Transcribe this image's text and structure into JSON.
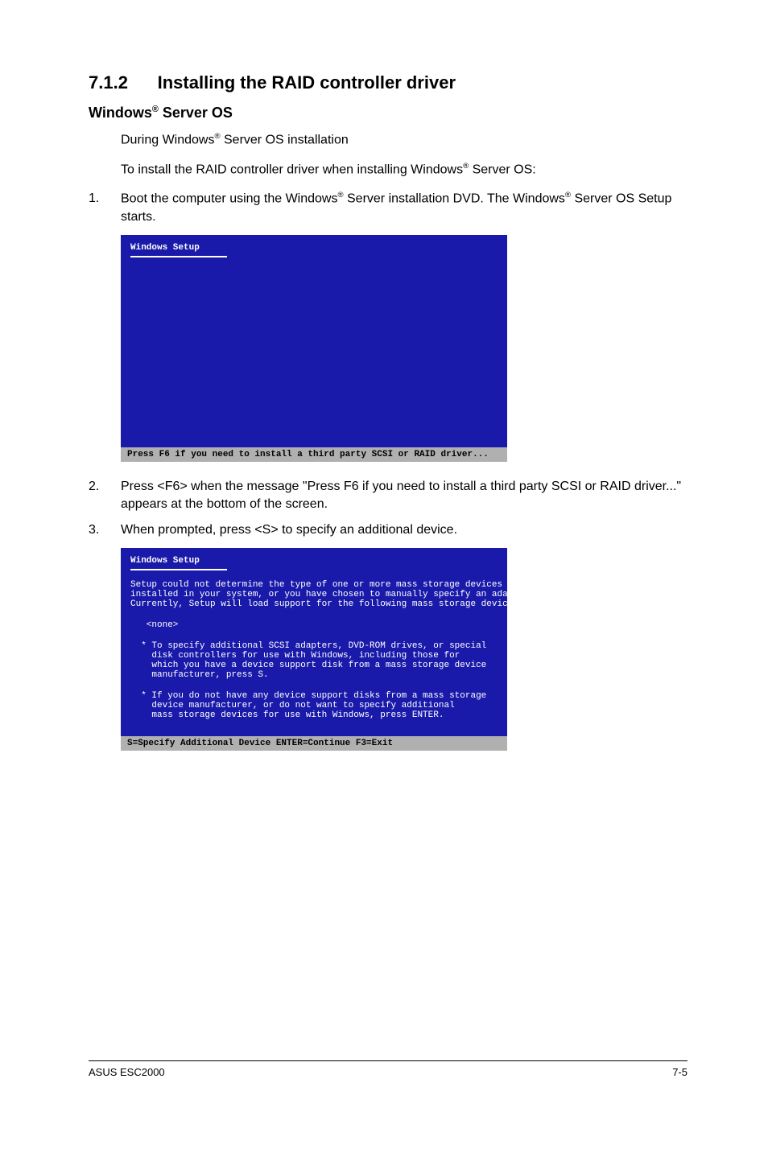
{
  "section": {
    "number": "7.1.2",
    "title": "Installing the RAID controller driver"
  },
  "subheading": {
    "prefix": "Windows",
    "reg": "®",
    "suffix": " Server OS"
  },
  "intro": {
    "line1_a": "During Windows",
    "line1_reg": "®",
    "line1_b": " Server OS installation",
    "line2_a": "To install the RAID controller driver when installing Windows",
    "line2_reg": "®",
    "line2_b": " Server OS:"
  },
  "step1": {
    "num": "1.",
    "a": "Boot the computer using the Windows",
    "reg1": "®",
    "b": " Server installation DVD. The Windows",
    "reg2": "®",
    "c": " Server OS Setup starts."
  },
  "ss1": {
    "title": "Windows Setup",
    "footer": "Press F6 if you need to install a third party SCSI or RAID driver..."
  },
  "step2": {
    "num": "2.",
    "text": "Press <F6> when the message \"Press F6 if you need to install a third party SCSI or RAID driver...\" appears at the bottom of the screen."
  },
  "step3": {
    "num": "3.",
    "text": "When prompted, press <S> to specify an additional device."
  },
  "ss2": {
    "title": "Windows Setup",
    "l1": "Setup could not determine the type of one or more mass storage devices",
    "l2": "installed in your system, or you have chosen to manually specify an adapter.",
    "l3": "Currently, Setup will load support for the following mass storage devices(s):",
    "none": "   <none>",
    "b1a": "  * To specify additional SCSI adapters, DVD-ROM drives, or special",
    "b1b": "    disk controllers for use with Windows, including those for",
    "b1c": "    which you have a device support disk from a mass storage device",
    "b1d": "    manufacturer, press S.",
    "b2a": "  * If you do not have any device support disks from a mass storage",
    "b2b": "    device manufacturer, or do not want to specify additional",
    "b2c": "    mass storage devices for use with Windows, press ENTER.",
    "footer": " S=Specify Additional Device    ENTER=Continue    F3=Exit"
  },
  "footer": {
    "left": "ASUS ESC2000",
    "right": "7-5"
  }
}
